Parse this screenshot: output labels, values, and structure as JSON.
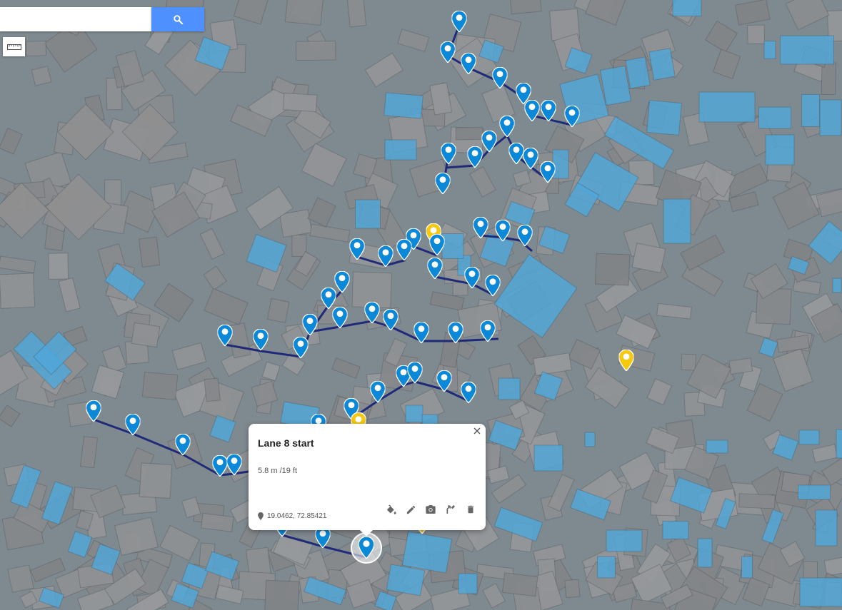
{
  "search": {
    "placeholder": "",
    "value": "",
    "icon": "search-icon"
  },
  "toolbar": {
    "ruler_icon": "ruler-icon"
  },
  "colors": {
    "background": "#7f8a90",
    "building_gray": "#8c8e90",
    "building_blue": "#4fa7d9",
    "path": "#1f2a78",
    "pin_blue": "#0b88d8",
    "pin_yellow": "#f6c90e",
    "search_button": "#4d90fe"
  },
  "popup": {
    "title": "Lane 8 start",
    "measurement": "5.8 m /19 ft",
    "coordinates": "19.0462, 72.85421",
    "tools": [
      "paint-bucket-icon",
      "pencil-icon",
      "camera-icon",
      "route-icon",
      "trash-icon"
    ]
  }
}
